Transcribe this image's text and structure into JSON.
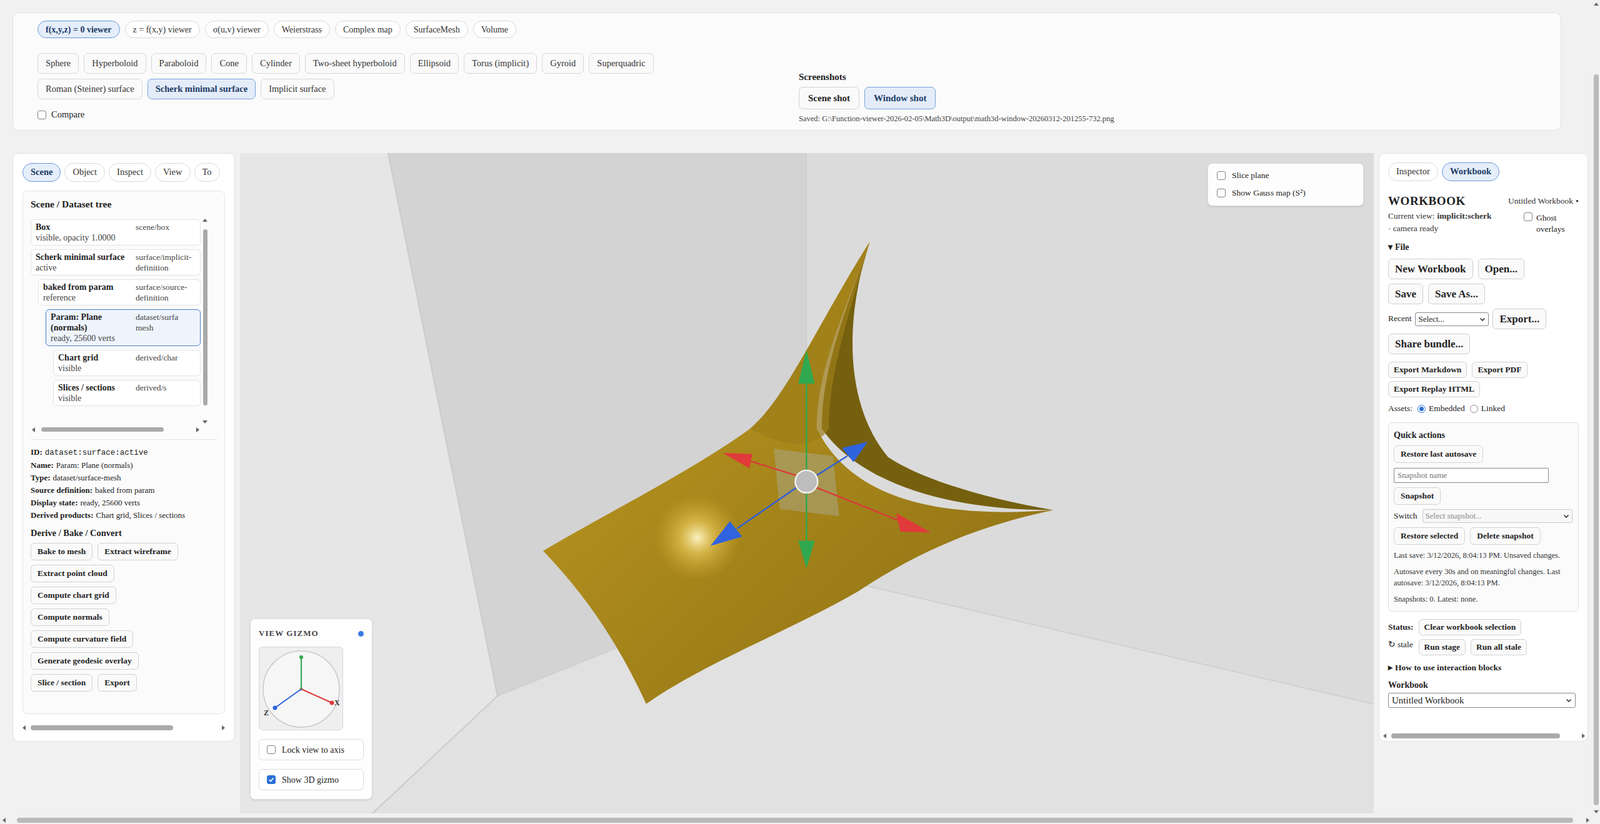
{
  "viewer_tabs": [
    {
      "label": "f(x,y,z) = 0 viewer",
      "selected": true
    },
    {
      "label": "z = f(x,y) viewer",
      "selected": false
    },
    {
      "label": "σ(u,v) viewer",
      "selected": false
    },
    {
      "label": "Weierstrass",
      "selected": false
    },
    {
      "label": "Complex map",
      "selected": false
    },
    {
      "label": "SurfaceMesh",
      "selected": false
    },
    {
      "label": "Volume",
      "selected": false
    }
  ],
  "shape_rows": [
    [
      {
        "label": "Sphere",
        "selected": false
      },
      {
        "label": "Hyperboloid",
        "selected": false
      },
      {
        "label": "Paraboloid",
        "selected": false
      },
      {
        "label": "Cone",
        "selected": false
      },
      {
        "label": "Cylinder",
        "selected": false
      },
      {
        "label": "Two-sheet hyperboloid",
        "selected": false
      },
      {
        "label": "Ellipsoid",
        "selected": false
      },
      {
        "label": "Torus (implicit)",
        "selected": false
      },
      {
        "label": "Gyroid",
        "selected": false
      },
      {
        "label": "Superquadric",
        "selected": false
      }
    ],
    [
      {
        "label": "Roman (Steiner) surface",
        "selected": false
      },
      {
        "label": "Scherk minimal surface",
        "selected": true
      },
      {
        "label": "Implicit surface",
        "selected": false
      }
    ]
  ],
  "compare": {
    "label": "Compare",
    "checked": false
  },
  "screenshots": {
    "title": "Screenshots",
    "buttons": [
      {
        "label": "Scene shot",
        "selected": false
      },
      {
        "label": "Window shot",
        "selected": true
      }
    ],
    "saved": "Saved: G:\\Function-viewer-2026-02-05\\Math3D\\output\\math3d-window-20260312-201255-732.png"
  },
  "left_panel": {
    "tabs": [
      {
        "label": "Scene",
        "selected": true
      },
      {
        "label": "Object",
        "selected": false
      },
      {
        "label": "Inspect",
        "selected": false
      },
      {
        "label": "View",
        "selected": false
      },
      {
        "label": "To",
        "selected": false
      }
    ],
    "tree_title": "Scene / Dataset tree",
    "tree": [
      {
        "name": "Box",
        "type": "scene/box",
        "status": "visible, opacity 1.0000",
        "depth": 0,
        "selected": false
      },
      {
        "name": "Scherk minimal surface",
        "type": "surface/implicit-definition",
        "status": "active",
        "depth": 0,
        "selected": false
      },
      {
        "name": "baked from param",
        "type": "surface/source-definition",
        "status": "reference",
        "depth": 1,
        "selected": false
      },
      {
        "name": "Param: Plane (normals)",
        "type": "dataset/surfa mesh",
        "status": "ready, 25600 verts",
        "depth": 2,
        "selected": true
      },
      {
        "name": "Chart grid",
        "type": "derived/char",
        "status": "visible",
        "depth": 3,
        "selected": false
      },
      {
        "name": "Slices / sections",
        "type": "derived/s",
        "status": "visible",
        "depth": 3,
        "selected": false
      }
    ],
    "details": [
      {
        "label": "ID:",
        "value": "dataset:surface:active",
        "kind": "code"
      },
      {
        "label": "Name:",
        "value": "Param: Plane (normals)",
        "kind": "text"
      },
      {
        "label": "Type:",
        "value": "dataset/surface-mesh",
        "kind": "text"
      },
      {
        "label": "Source definition:",
        "value": "baked from param",
        "kind": "text"
      },
      {
        "label": "Display state:",
        "value": "ready, 25600 verts",
        "kind": "text"
      },
      {
        "label": "Derived products:",
        "value": "Chart grid, Slices / sections",
        "kind": "text"
      }
    ],
    "derive_title": "Derive / Bake / Convert",
    "derive_buttons": [
      "Bake to mesh",
      "Extract wireframe",
      "Extract point cloud",
      "Compute chart grid",
      "Compute normals",
      "Compute curvature field",
      "Generate geodesic overlay",
      "Slice / section",
      "Export"
    ]
  },
  "viewport": {
    "scene_options": [
      {
        "label": "Slice plane",
        "checked": false
      },
      {
        "label": "Show Gauss map (S²)",
        "checked": false
      }
    ],
    "view_gizmo": {
      "title": "VIEW GIZMO",
      "active": true,
      "axes": [
        "Z",
        "X"
      ],
      "options": [
        {
          "label": "Lock view to axis",
          "checked": false
        },
        {
          "label": "Show 3D gizmo",
          "checked": true
        }
      ]
    }
  },
  "right_panel": {
    "tabs": [
      {
        "label": "Inspector",
        "selected": false
      },
      {
        "label": "Workbook",
        "selected": true
      }
    ],
    "title": "WORKBOOK",
    "doc_name": "Untitled Workbook",
    "unsaved_marker": "•",
    "current_view": {
      "label": "Current view:",
      "value": "implicit:scherk",
      "note": "· camera ready"
    },
    "ghost": {
      "label": "Ghost overlays",
      "checked": false
    },
    "file": {
      "marker": "▾",
      "label": "File"
    },
    "file_rows": [
      [
        "New Workbook",
        "Open..."
      ],
      [
        "Save",
        "Save As..."
      ]
    ],
    "recent": {
      "label": "Recent",
      "value": "Select...",
      "action": "Export..."
    },
    "share": "Share bundle...",
    "exports": [
      "Export Markdown",
      "Export PDF",
      "Export Replay HTML"
    ],
    "assets": {
      "label": "Assets:",
      "options": [
        {
          "label": "Embedded",
          "selected": true
        },
        {
          "label": "Linked",
          "selected": false
        }
      ]
    },
    "quick_actions": {
      "title": "Quick actions",
      "restore_autosave": "Restore last autosave",
      "snapshot_placeholder": "Snapshot name",
      "snapshot": "Snapshot",
      "switch_label": "Switch",
      "switch_value": "Select snapshot...",
      "switch_disabled": true,
      "restore_selected": "Restore selected",
      "delete_snapshot": "Delete snapshot",
      "notes": [
        "Last save: 3/12/2026, 8:04:13 PM. Unsaved changes.",
        "Autosave every 30s and on meaningful changes. Last autosave: 3/12/2026, 8:04:13 PM.",
        "Snapshots: 0. Latest: none."
      ]
    },
    "status": {
      "label": "Status:",
      "icon": "↻",
      "state": "stale",
      "buttons": [
        "Clear workbook selection",
        "Run stage",
        "Run all stale"
      ]
    },
    "howto": {
      "marker": "▸",
      "label": "How to use interaction blocks"
    },
    "workbook_select": {
      "label": "Workbook",
      "value": "Untitled Workbook"
    }
  }
}
